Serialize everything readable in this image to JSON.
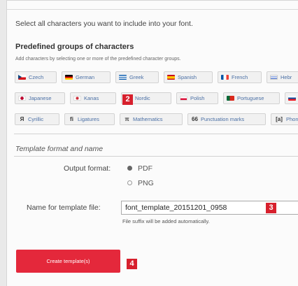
{
  "intro_text": "Select all characters you want to include into your font.",
  "groups": {
    "title": "Predefined groups of characters",
    "subtitle": "Add characters by selecting one or more of the predefined character groups.",
    "row1": [
      {
        "label": "Czech",
        "icon": "flag-czech-icon",
        "colors": [
          "#ffffff",
          "#d7141a",
          "#11457e"
        ]
      },
      {
        "label": "German",
        "icon": "flag-germany-icon",
        "colors": [
          "#000000",
          "#dd0000",
          "#ffce00"
        ]
      },
      {
        "label": "Greek",
        "icon": "flag-greece-icon",
        "colors": [
          "#0d5eaf",
          "#ffffff",
          "#0d5eaf"
        ]
      },
      {
        "label": "Spanish",
        "icon": "flag-spain-icon",
        "colors": [
          "#c60b1e",
          "#ffc400",
          "#c60b1e"
        ]
      },
      {
        "label": "French",
        "icon": "flag-france-icon",
        "colors": [
          "#0055a4",
          "#ffffff",
          "#ef4135"
        ]
      },
      {
        "label": "Hebr",
        "icon": "flag-israel-icon",
        "colors": [
          "#ffffff",
          "#0038b8",
          "#ffffff"
        ]
      }
    ],
    "row2": [
      {
        "label": "Japanese",
        "icon": "flag-japan-icon",
        "colors": [
          "#ffffff",
          "#bc002d",
          "#ffffff"
        ]
      },
      {
        "label": "Kanas",
        "icon": "flag-korea-icon",
        "colors": [
          "#ffffff",
          "#cd2e3a",
          "#ffffff"
        ]
      },
      {
        "label": "Nordic",
        "icon": "flag-nordic-icon",
        "colors": [
          "#c8102e",
          "#ffffff",
          "#c8102e"
        ]
      },
      {
        "label": "Polish",
        "icon": "flag-poland-icon",
        "colors": [
          "#ffffff",
          "#ffffff",
          "#dc143c"
        ]
      },
      {
        "label": "Portuguese",
        "icon": "flag-portugal-icon",
        "colors": [
          "#046a38",
          "#da291c",
          "#da291c"
        ]
      },
      {
        "label": "",
        "icon": "flag-slovakia-icon",
        "colors": [
          "#ffffff",
          "#0b4ea2",
          "#ee1c25"
        ]
      }
    ],
    "row3": [
      {
        "label": "Cyrillic",
        "symbol": "Я",
        "icon": "cyrillic-symbol-icon"
      },
      {
        "label": "Ligatures",
        "symbol": "fi",
        "icon": "ligature-symbol-icon"
      },
      {
        "label": "Mathematics",
        "symbol": "π",
        "icon": "math-symbol-icon"
      },
      {
        "label": "Punctuation marks",
        "symbol": "66",
        "icon": "quote-symbol-icon"
      },
      {
        "label": "Phone",
        "symbol": "[a]",
        "icon": "phonetic-symbol-icon"
      }
    ]
  },
  "template": {
    "section_title": "Template format and name",
    "output_label": "Output format:",
    "options": [
      "PDF",
      "PNG"
    ],
    "selected": "PDF",
    "name_label": "Name for template file:",
    "name_value": "font_template_20151201_0958",
    "hint": "File suffix will be added automatically.",
    "create_button": "Create template(s)"
  },
  "badges": [
    "2",
    "3",
    "4"
  ],
  "accent_color": "#e4283b"
}
